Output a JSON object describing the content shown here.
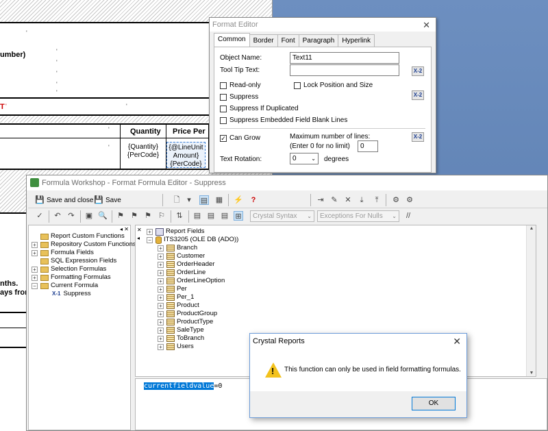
{
  "report": {
    "text_umber": "umber)",
    "header_quantity": "Quantity",
    "header_price": "Price Per",
    "field_quantity": "{Quantity}\n{PerCode}",
    "field_price": "{@LineUnit\nAmount}\n{PerCode}",
    "text_nths": "nths.",
    "text_aysfrom": "ays from",
    "text_t": "T"
  },
  "format_editor": {
    "title": "Format Editor",
    "tabs": [
      "Common",
      "Border",
      "Font",
      "Paragraph",
      "Hyperlink"
    ],
    "object_name_label": "Object Name:",
    "object_name_value": "Text11",
    "tooltip_label": "Tool Tip Text:",
    "tooltip_value": "",
    "read_only": "Read-only",
    "lock_position": "Lock Position and Size",
    "suppress": "Suppress",
    "suppress_duplicated": "Suppress If Duplicated",
    "suppress_blank": "Suppress Embedded Field Blank Lines",
    "can_grow": "Can Grow",
    "max_lines_label": "Maximum number of lines:",
    "max_lines_hint": "(Enter 0 for no limit)",
    "max_lines_value": "0",
    "rotation_label": "Text Rotation:",
    "rotation_value": "0",
    "rotation_unit": "degrees",
    "formula_button": "X-2"
  },
  "workshop": {
    "title": "Formula Workshop - Format Formula Editor - Suppress",
    "save_close": "Save and close",
    "save": "Save",
    "syntax_combo": "Crystal Syntax",
    "nulls_combo": "Exceptions For Nulls",
    "left_tree": [
      {
        "label": "Report Custom Functions",
        "pm": ""
      },
      {
        "label": "Repository Custom Functions",
        "pm": "+"
      },
      {
        "label": "Formula Fields",
        "pm": "+"
      },
      {
        "label": "SQL Expression Fields",
        "pm": ""
      },
      {
        "label": "Selection Formulas",
        "pm": "+"
      },
      {
        "label": "Formatting Formulas",
        "pm": "+"
      },
      {
        "label": "Current Formula",
        "pm": "−"
      }
    ],
    "current_formula_child": "Suppress",
    "current_formula_icon": "X-1",
    "right_tree_root1": "Report Fields",
    "right_tree_root2": "ITS3205 (OLE DB (ADO))",
    "tables": [
      "Branch",
      "Customer",
      "OrderHeader",
      "OrderLine",
      "OrderLineOption",
      "Per",
      "Per_1",
      "Product",
      "ProductGroup",
      "ProductType",
      "SaleType",
      "ToBranch",
      "Users"
    ],
    "code_highlight": "currentfieldvalue",
    "code_rest": "=0"
  },
  "message_box": {
    "title": "Crystal Reports",
    "message": "This function can only be used in field formatting formulas.",
    "ok": "OK"
  }
}
